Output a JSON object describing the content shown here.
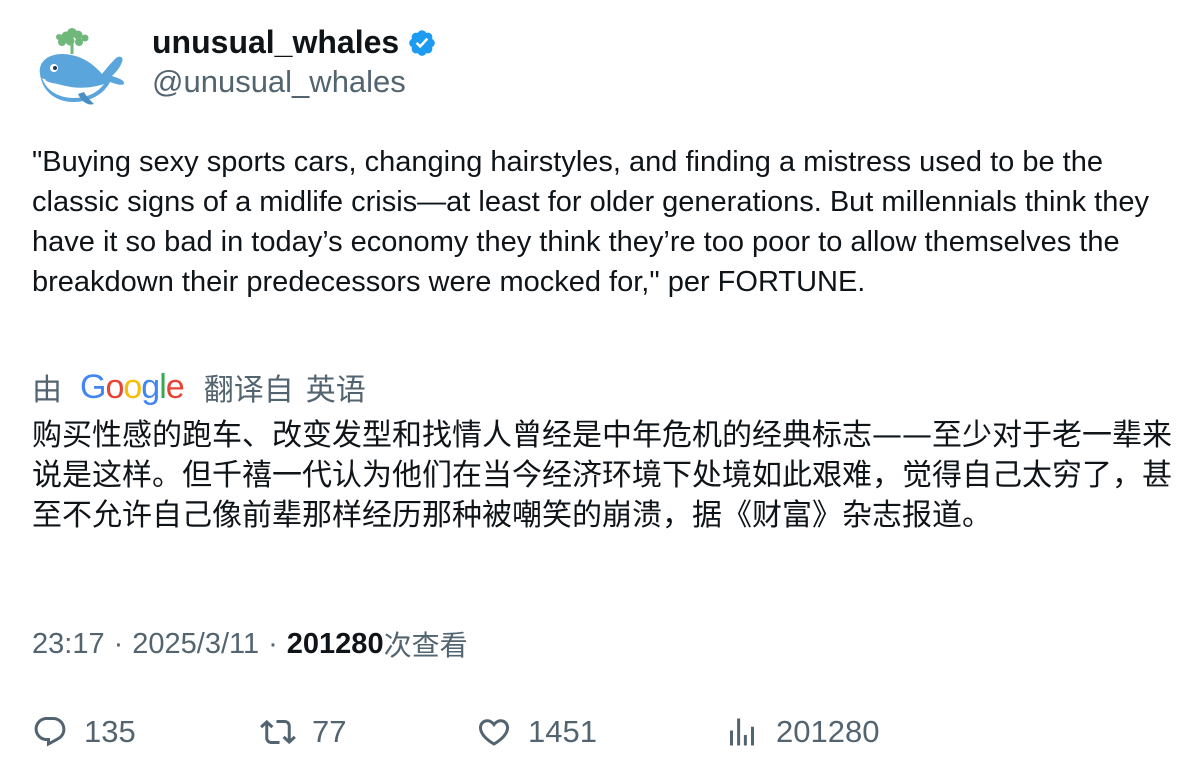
{
  "author": {
    "display_name": "unusual_whales",
    "handle": "@unusual_whales",
    "verified": true
  },
  "tweet": {
    "text": "\"Buying sexy sports cars, changing hairstyles, and finding a mistress used to be the classic signs of a midlife crisis—at least for older generations. But millennials think they have it so bad in today’s economy they think they’re too poor to allow themselves the breakdown their predecessors were mocked for,\" per FORTUNE."
  },
  "translation": {
    "by_label": "由",
    "provider": "Google",
    "from_label": "翻译自",
    "source_language": "英语",
    "text": "购买性感的跑车、改变发型和找情人曾经是中年危机的经典标志——至少对于老一辈来说是这样。但千禧一代认为他们在当今经济环境下处境如此艰难，觉得自己太穷了，甚至不允许自己像前辈那样经历那种被嘲笑的崩溃，据《财富》杂志报道。"
  },
  "meta": {
    "time": "23:17",
    "separator": "·",
    "date": "2025/3/11",
    "views_count": "201280",
    "views_label": "次查看"
  },
  "actions": {
    "replies": "135",
    "retweets": "77",
    "likes": "1451",
    "views": "201280"
  },
  "colors": {
    "text_primary": "#0f1419",
    "text_secondary": "#536471",
    "verified_blue": "#1d9bf0",
    "whale_blue": "#5aa5dc"
  },
  "icons": {
    "reply": "reply-icon",
    "retweet": "retweet-icon",
    "like": "heart-icon",
    "views": "analytics-icon",
    "verified": "verified-badge-icon"
  }
}
